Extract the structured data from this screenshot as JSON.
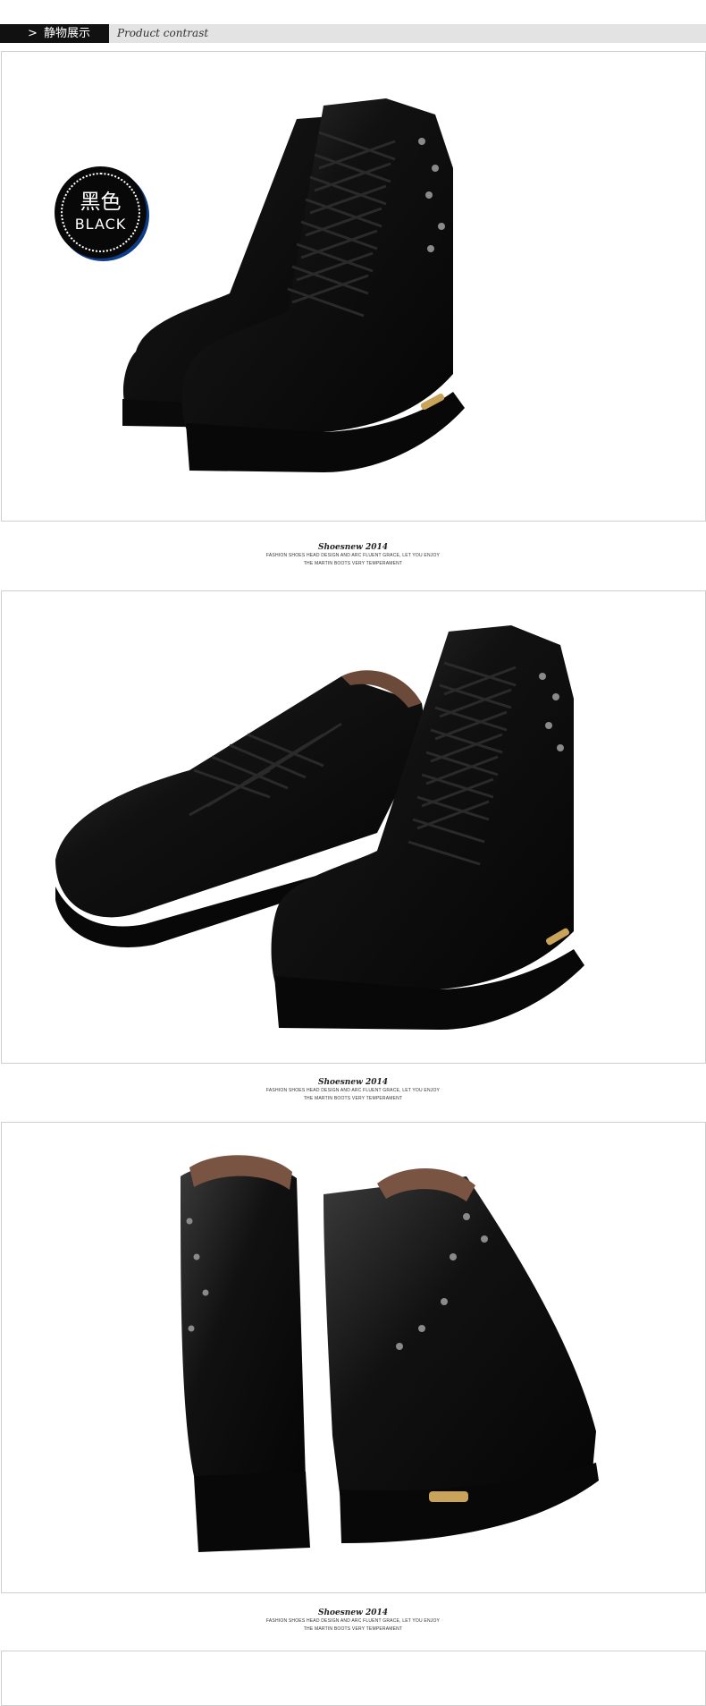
{
  "header": {
    "arrow": ">",
    "title": "静物展示",
    "subtitle": "Product contrast"
  },
  "badge": {
    "color_cn": "黑色",
    "color_en": "BLACK"
  },
  "captions": [
    {
      "signature": "Shoesnew 2014",
      "line1": "FASHION SHOES HEAD DESIGN AND ARC FLUENT GRACE, LET YOU ENJOY",
      "line2": "THE MARTIN BOOTS VERY TEMPERAMENT"
    },
    {
      "signature": "Shoesnew 2014",
      "line1": "FASHION SHOES HEAD DESIGN AND ARC FLUENT GRACE, LET YOU ENJOY",
      "line2": "THE MARTIN BOOTS VERY TEMPERAMENT"
    },
    {
      "signature": "Shoesnew 2014",
      "line1": "FASHION SHOES HEAD DESIGN AND ARC FLUENT GRACE, LET YOU ENJOY",
      "line2": "THE MARTIN BOOTS VERY TEMPERAMENT"
    }
  ],
  "colors": {
    "header_bg": "#e3e3e3",
    "tab_bg": "#111111",
    "frame_border": "#cfcfcf",
    "boot_black": "#0d0d0d",
    "plate_gold": "#c9a35a",
    "badge_shadow": "#0b3d8a"
  },
  "images": [
    {
      "name": "boots-front-view-icon"
    },
    {
      "name": "boots-side-view-icon"
    },
    {
      "name": "boots-back-view-icon"
    }
  ]
}
